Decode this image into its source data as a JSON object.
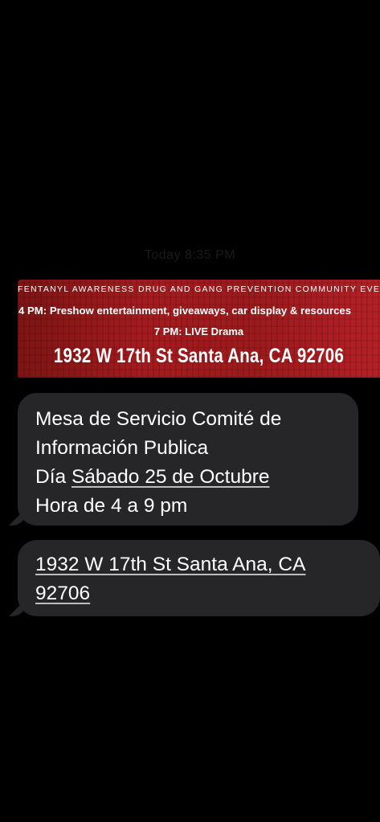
{
  "conversation": {
    "timestamp": "Today 8:35 PM",
    "flyer": {
      "header": "FENTANYL AWARENESS DRUG AND GANG PREVENTION COMMUNITY EVENT",
      "preshow": "4 PM: Preshow entertainment, giveaways, car display & resources",
      "drama": "7 PM: LIVE Drama",
      "address": "1932 W 17th St Santa Ana, CA  92706"
    },
    "message1": {
      "line1": "Mesa de Servicio Comité de",
      "line2": "Información Publica",
      "line3_prefix": "Día ",
      "line3_link": "Sábado 25 de Octubre",
      "line4": "Hora de 4 a 9  pm"
    },
    "message2": {
      "link_line1": "1932 W 17th St Santa Ana, CA",
      "link_line2": "92706"
    }
  },
  "colors": {
    "background": "#000000",
    "bubble": "#262628",
    "flyer_red": "#a41b1e",
    "text": "#ffffff"
  }
}
